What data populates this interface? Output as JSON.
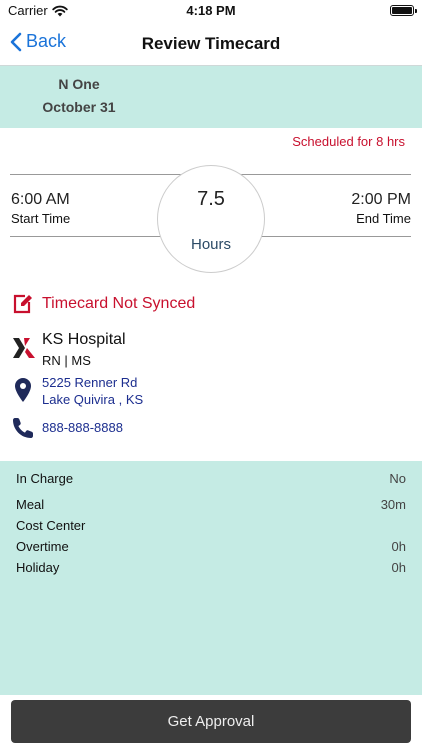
{
  "status_bar": {
    "carrier": "Carrier",
    "time": "4:18 PM"
  },
  "nav": {
    "back_label": "Back",
    "title": "Review Timecard"
  },
  "header": {
    "name": "N One",
    "date": "October 31"
  },
  "schedule": {
    "text": "Scheduled for 8 hrs"
  },
  "time": {
    "start_value": "6:00 AM",
    "start_label": "Start Time",
    "end_value": "2:00 PM",
    "end_label": "End Time",
    "hours_value": "7.5",
    "hours_label": "Hours"
  },
  "sync": {
    "text": "Timecard Not Synced"
  },
  "facility": {
    "name": "KS Hospital",
    "unit": "RN | MS",
    "address_line1": "5225 Renner Rd",
    "address_line2": "Lake Quivira , KS",
    "phone": "888-888-8888"
  },
  "details": [
    {
      "label": "In Charge",
      "value": "No"
    },
    {
      "label": "Meal",
      "value": "30m"
    },
    {
      "label": "Cost Center",
      "value": ""
    },
    {
      "label": "Overtime",
      "value": "0h"
    },
    {
      "label": "Holiday",
      "value": "0h"
    }
  ],
  "action": {
    "label": "Get Approval"
  },
  "icons": {
    "wifi": "wifi-icon",
    "battery": "battery-icon",
    "back": "chevron-left-icon",
    "edit": "edit-icon",
    "logo": "facility-logo",
    "pin": "location-pin-icon",
    "phone": "phone-icon"
  },
  "colors": {
    "accent": "#1a73d9",
    "band": "#c5ebe4",
    "alert": "#c8102e",
    "link": "#1c2e8f",
    "button": "#3c3c3c"
  }
}
